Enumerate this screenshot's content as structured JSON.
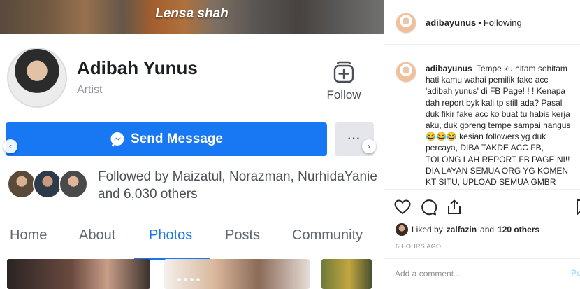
{
  "facebook": {
    "cover_title": "Lensa shah",
    "page_name": "Adibah Yunus",
    "category": "Artist",
    "follow_label": "Follow",
    "send_message_label": "Send Message",
    "more_label": "···",
    "followed_by": "Followed by Maizatul, Norazman, NurhidaYanie and 6,030 others",
    "tabs": [
      "Home",
      "About",
      "Photos",
      "Posts",
      "Community"
    ],
    "active_tab": "Photos",
    "accent_color": "#1877f2"
  },
  "instagram": {
    "username": "adibayunus",
    "following_label": "Following",
    "caption_user": "adibayunus",
    "caption_text": "Tempe ku hitam sehitam hati kamu wahai pemilik fake acc 'adibah yunus' di FB Page! ! ! Kenapa dah report byk kali tp still ada? Pasal duk fikir fake acc ko buat tu habis kerja aku, duk goreng tempe sampai hangus 😂😂😂 kesian followers yg duk percaya, DIBA TAKDE ACC FB, TOLONG LAH REPORT FB PAGE NI!! DIA LAYAN SEMUA ORG YG KOMEN KT SITU, UPLOAD SEMUA GMBR",
    "liked_prefix": "Liked by",
    "liked_user": "zalfazin",
    "liked_and": "and",
    "liked_others": "120 others",
    "time_ago": "6 HOURS AGO",
    "comment_placeholder": "Add a comment...",
    "post_label": "Po"
  }
}
